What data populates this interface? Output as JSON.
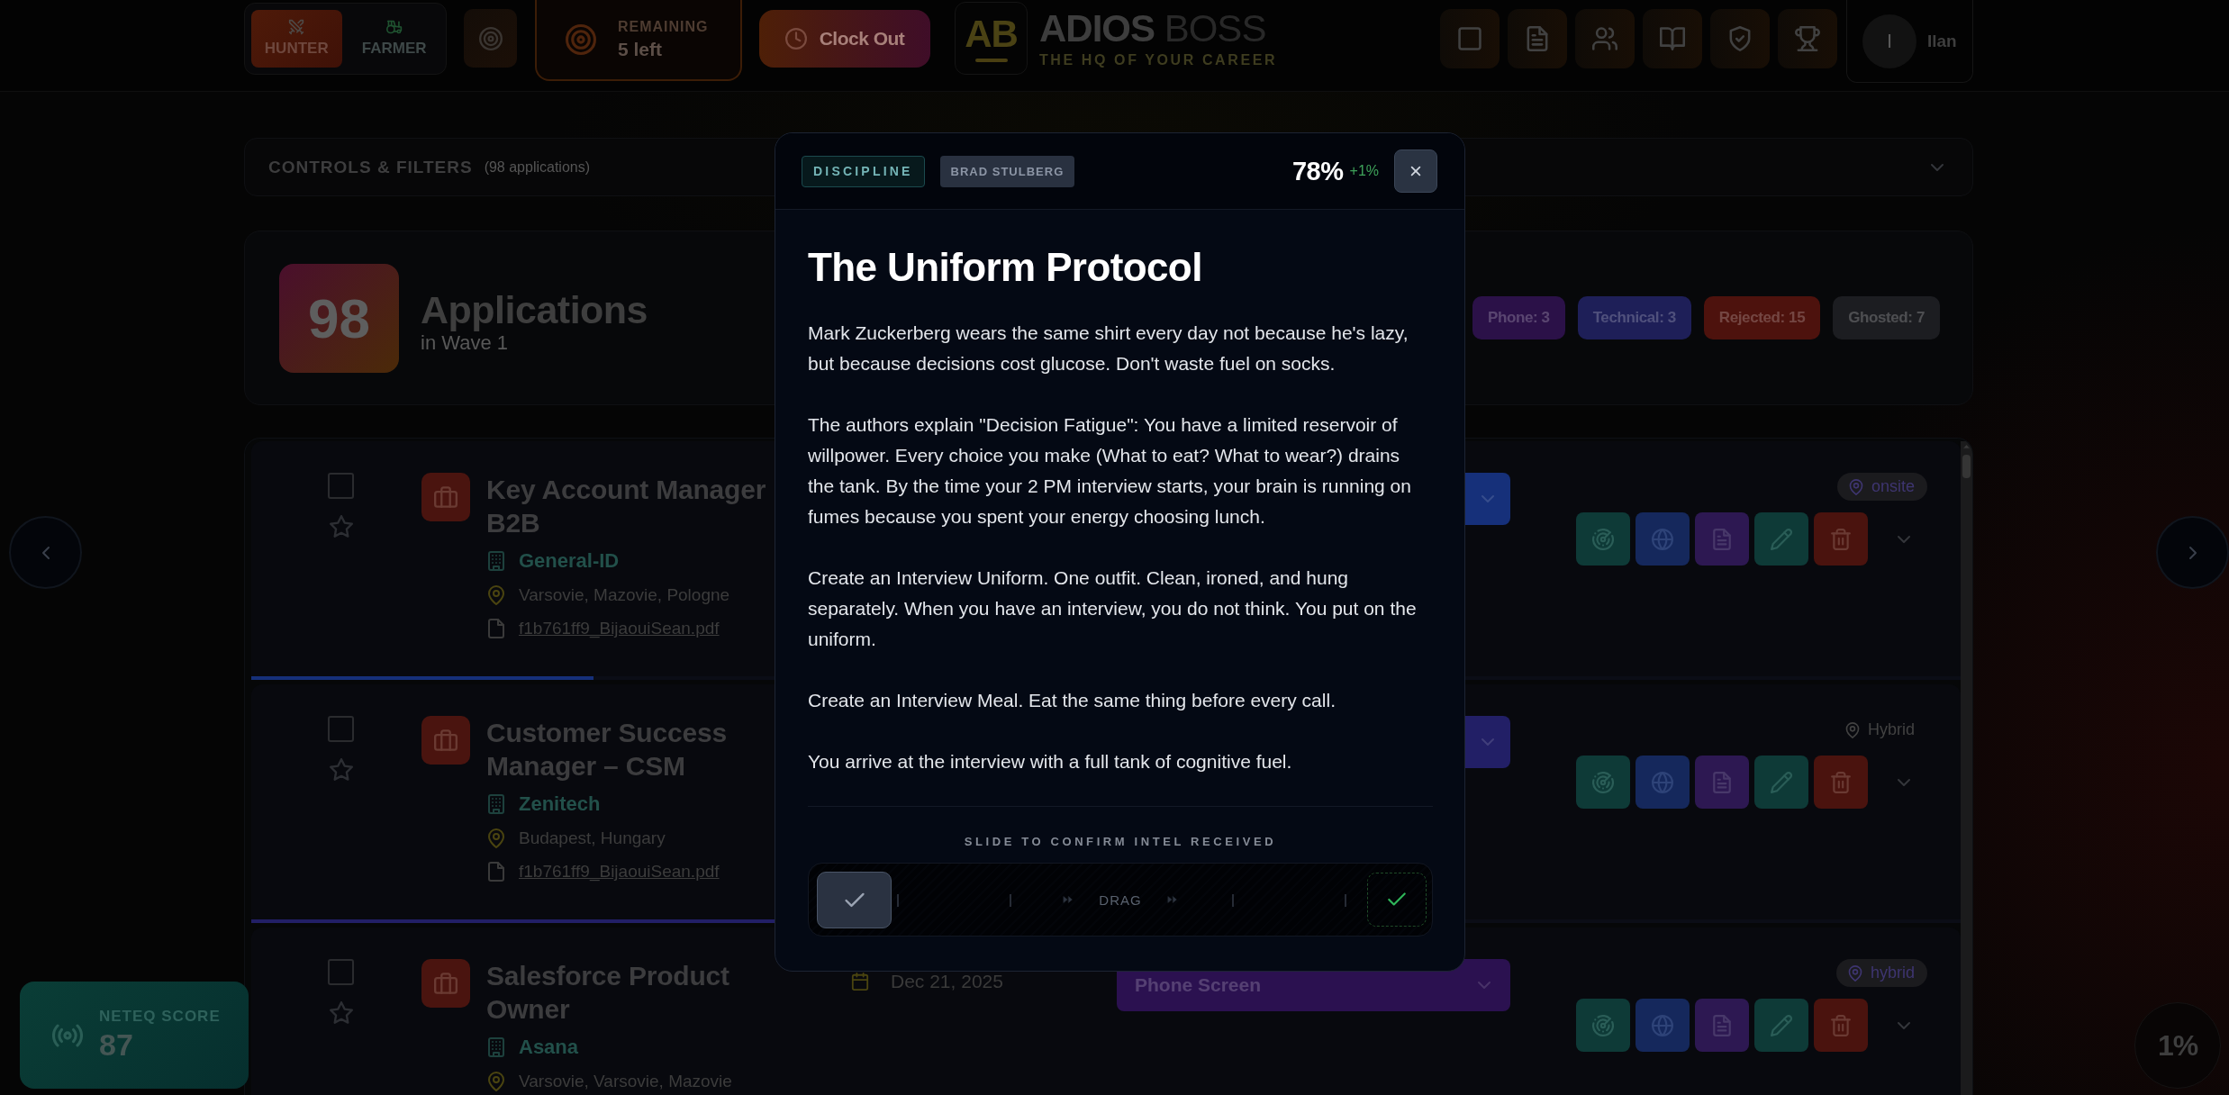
{
  "top_bar": {
    "mode_toggle": [
      {
        "label": "HUNTER",
        "kind": "hunter",
        "selected": true
      },
      {
        "label": "FARMER",
        "kind": "farmer",
        "selected": false
      }
    ],
    "remaining": {
      "label": "REMAINING",
      "value": "5 left"
    },
    "clock_out": "Clock Out",
    "logo": {
      "mark": "AB",
      "name": "**ADIOS** BOSS",
      "tagline": "THE HQ OF YOUR CAREER"
    },
    "user": {
      "initial": "I",
      "name": "Ilan"
    }
  },
  "controls_bar": {
    "title": "CONTROLS & FILTERS",
    "count": "(98 applications)",
    "expanded": false
  },
  "summary": {
    "count": "98",
    "title": "Applications",
    "subtitle": "in Wave 1",
    "status_chips": [
      {
        "label": "Phone: 3",
        "color": "#2b1148"
      },
      {
        "label": "Technical: 3",
        "color": "#1e1f58"
      },
      {
        "label": "Rejected: 15",
        "color": "#4d120d"
      },
      {
        "label": "Ghosted: 7",
        "color": "#1c1d21"
      }
    ]
  },
  "applications": [
    {
      "title": "Key Account Manager B2B",
      "company": "General-ID",
      "location": "Varsovie, Mazovie, Pologne",
      "file": "f1b761ff9_BijaouiSean.pdf",
      "checked": false,
      "starred": false,
      "status": {
        "color": "#16307a"
      },
      "work_mode": {
        "label": "onsite",
        "filled": true
      },
      "progress": {
        "level": 0.2
      }
    },
    {
      "title": "Customer Success Manager – CSM",
      "company": "Zenitech",
      "location": "Budapest, Hungary",
      "file": "f1b761ff9_BijaouiSean.pdf",
      "checked": false,
      "starred": false,
      "status": {
        "color": "#221f66"
      },
      "work_mode": {
        "label": "Hybrid",
        "filled": false
      },
      "progress": {
        "level": 0.4
      }
    },
    {
      "title": "Salesforce Product Owner",
      "company": "Asana",
      "location": "Varsovie, Varsovie, Mazovie",
      "date": "Dec 21, 2025",
      "checked": false,
      "starred": false,
      "status": {
        "label": "Phone Screen",
        "color": "#2b1150"
      },
      "work_mode": {
        "label": "hybrid",
        "filled": true
      }
    }
  ],
  "score_card": {
    "label": "NETEQ SCORE",
    "value": "87"
  },
  "progress_badge": "1%",
  "modal": {
    "tags": [
      {
        "label": "DISCIPLINE",
        "kind": "category"
      },
      {
        "label": "BRAD STULBERG",
        "kind": "author"
      }
    ],
    "score": "78%",
    "delta": "+1%",
    "title": "The Uniform Protocol",
    "paragraphs": [
      "Mark Zuckerberg wears the same shirt every day not because he's lazy, but because decisions cost glucose. Don't waste fuel on socks.",
      "The authors explain \"Decision Fatigue\": You have a limited reservoir of willpower. Every choice you make (What to eat? What to wear?) drains the tank. By the time your 2 PM interview starts, your brain is running on fumes because you spent your energy choosing lunch.",
      "Create an Interview Uniform. One outfit. Clean, ironed, and hung separately. When you have an interview, you do not think. You put on the uniform.",
      "Create an Interview Meal. Eat the same thing before every call.",
      "You arrive at the interview with a full tank of cognitive fuel."
    ],
    "confirm": {
      "label": "SLIDE TO CONFIRM INTEL RECEIVED",
      "hint": "DRAG",
      "level": 0
    }
  }
}
